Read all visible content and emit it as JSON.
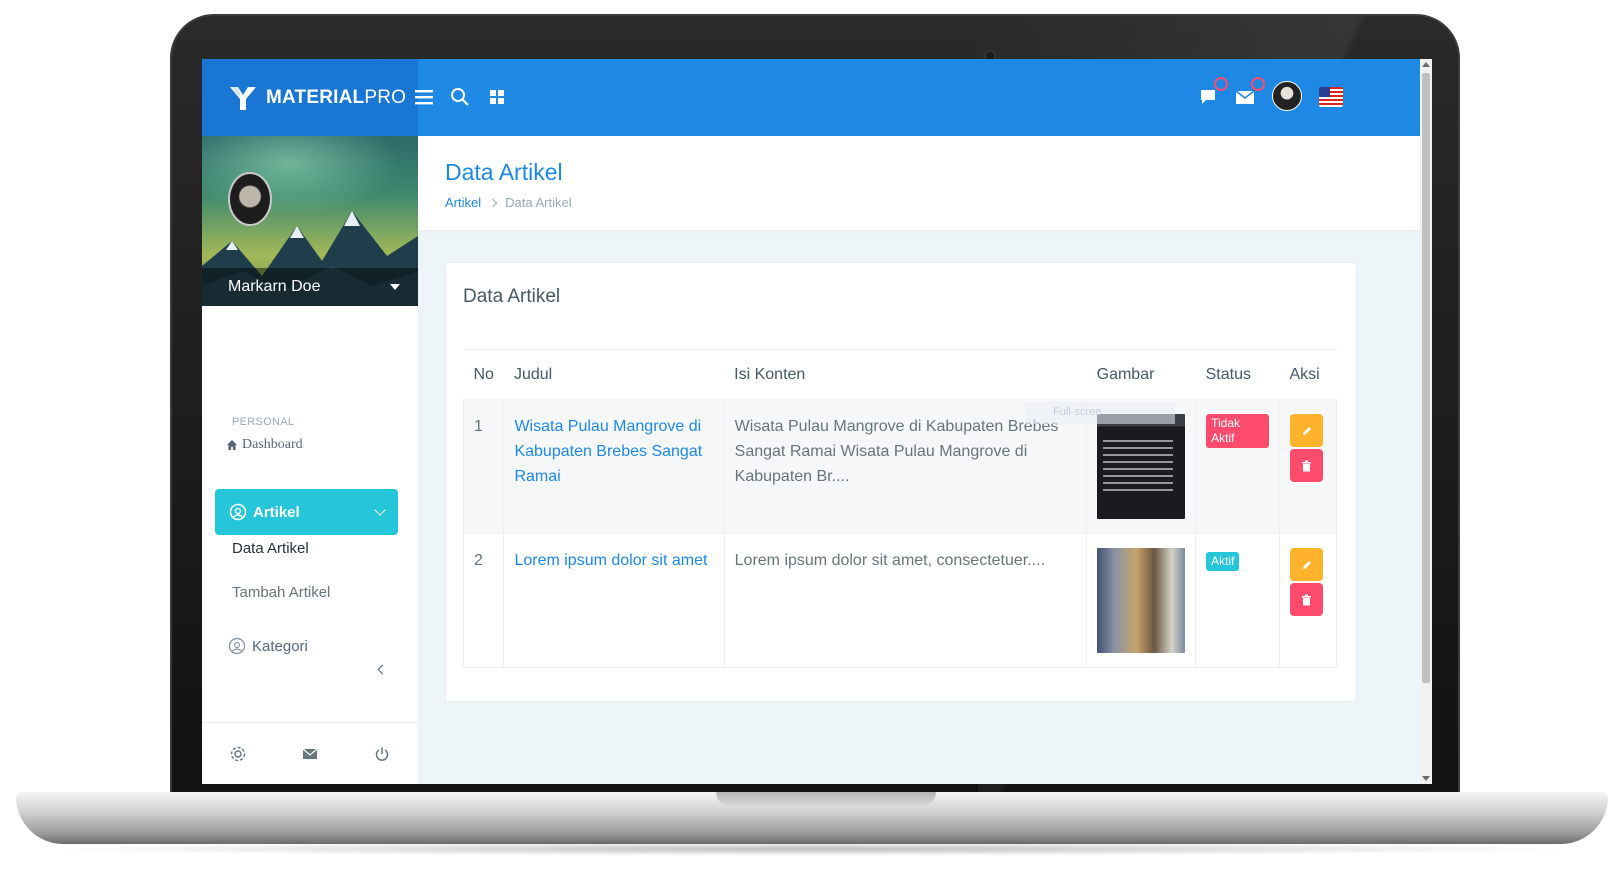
{
  "brand": {
    "name_bold": "MATERIAL",
    "name_light": "PRO",
    "logo_icon": "material-pro-logo-icon"
  },
  "topbar": {
    "icons": [
      "menu-icon",
      "search-icon",
      "grid-icon",
      "message-icon",
      "email-icon",
      "avatar",
      "us-flag-icon"
    ],
    "accent": "#1e88e5"
  },
  "sidebar": {
    "user_name": "Markarn Doe",
    "section_label": "PERSONAL",
    "dashboard_label": "Dashboard",
    "active_item": "Artikel",
    "sub_items": [
      "Data Artikel",
      "Tambah Artikel"
    ],
    "kategori_label": "Kategori",
    "footer_icons": [
      "gear-icon",
      "mail-icon",
      "power-icon"
    ],
    "active_color": "#26c6da"
  },
  "page": {
    "title": "Data Artikel",
    "breadcrumb": [
      "Artikel",
      "Data Artikel"
    ]
  },
  "card": {
    "title": "Data Artikel",
    "columns": [
      "No",
      "Judul",
      "Isi Konten",
      "Gambar",
      "Status",
      "Aksi"
    ],
    "rows": [
      {
        "no": "1",
        "judul": "Wisata Pulau Mangrove di Kabupaten Brebes Sangat Ramai",
        "isi": "Wisata Pulau Mangrove di Kabupaten Brebes Sangat Ramai Wisata Pulau Mangrove di Kabupaten Br....",
        "status": "Tidak Aktif",
        "status_color": "#fc4b6c"
      },
      {
        "no": "2",
        "judul": "Lorem ipsum dolor sit amet",
        "isi": "Lorem ipsum dolor sit amet, consectetuer....",
        "status": "Aktif",
        "status_color": "#26c6da"
      }
    ],
    "tooltip_fragment": "Full-scree"
  }
}
